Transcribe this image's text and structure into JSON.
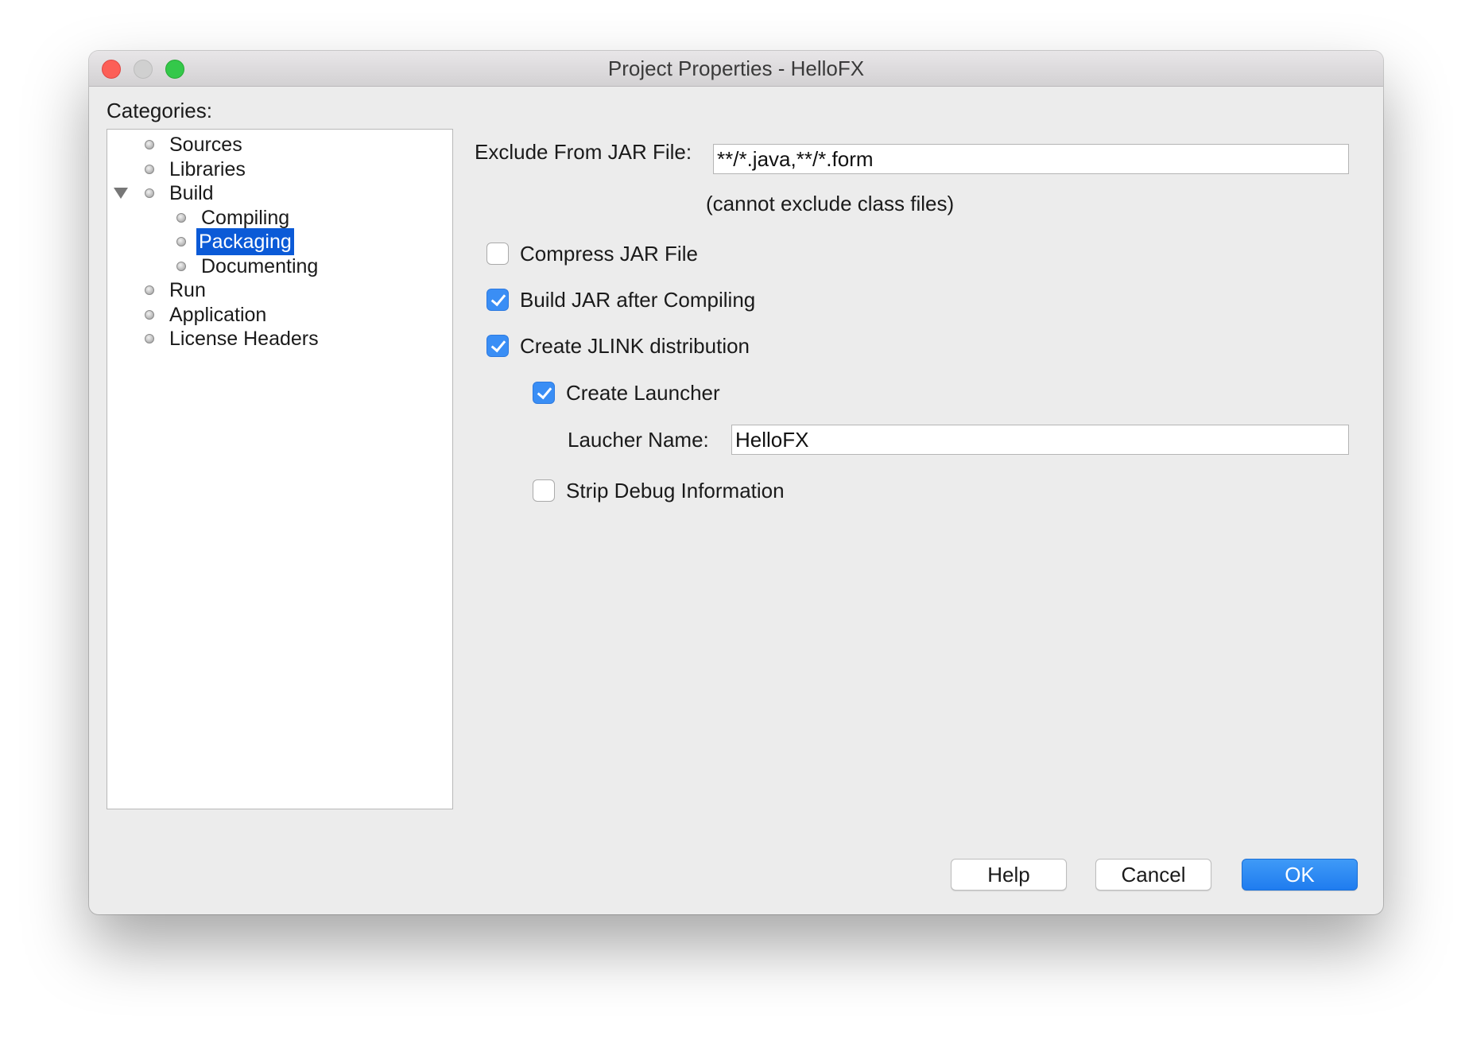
{
  "window": {
    "title": "Project Properties - HelloFX"
  },
  "sidebar": {
    "label": "Categories:",
    "items": [
      {
        "label": "Sources"
      },
      {
        "label": "Libraries"
      },
      {
        "label": "Build",
        "expanded": true
      },
      {
        "label": "Compiling"
      },
      {
        "label": "Packaging",
        "selected": true
      },
      {
        "label": "Documenting"
      },
      {
        "label": "Run"
      },
      {
        "label": "Application"
      },
      {
        "label": "License Headers"
      }
    ]
  },
  "main": {
    "exclude": {
      "label": "Exclude From JAR File:",
      "value": "**/*.java,**/*.form",
      "hint": "(cannot exclude class files)"
    },
    "compress": {
      "label": "Compress JAR File",
      "checked": false
    },
    "build_jar": {
      "label": "Build JAR after Compiling",
      "checked": true
    },
    "jlink": {
      "label": "Create JLINK distribution",
      "checked": true
    },
    "launcher": {
      "label": "Create Launcher",
      "checked": true
    },
    "launcher_name": {
      "label": "Laucher Name:",
      "value": "HelloFX"
    },
    "strip_debug": {
      "label": "Strip Debug Information",
      "checked": false
    }
  },
  "buttons": {
    "help": "Help",
    "cancel": "Cancel",
    "ok": "OK"
  },
  "colors": {
    "accent": "#1f7cef",
    "selection": "#0b5ad7",
    "checkbox": "#3a8ef5"
  }
}
